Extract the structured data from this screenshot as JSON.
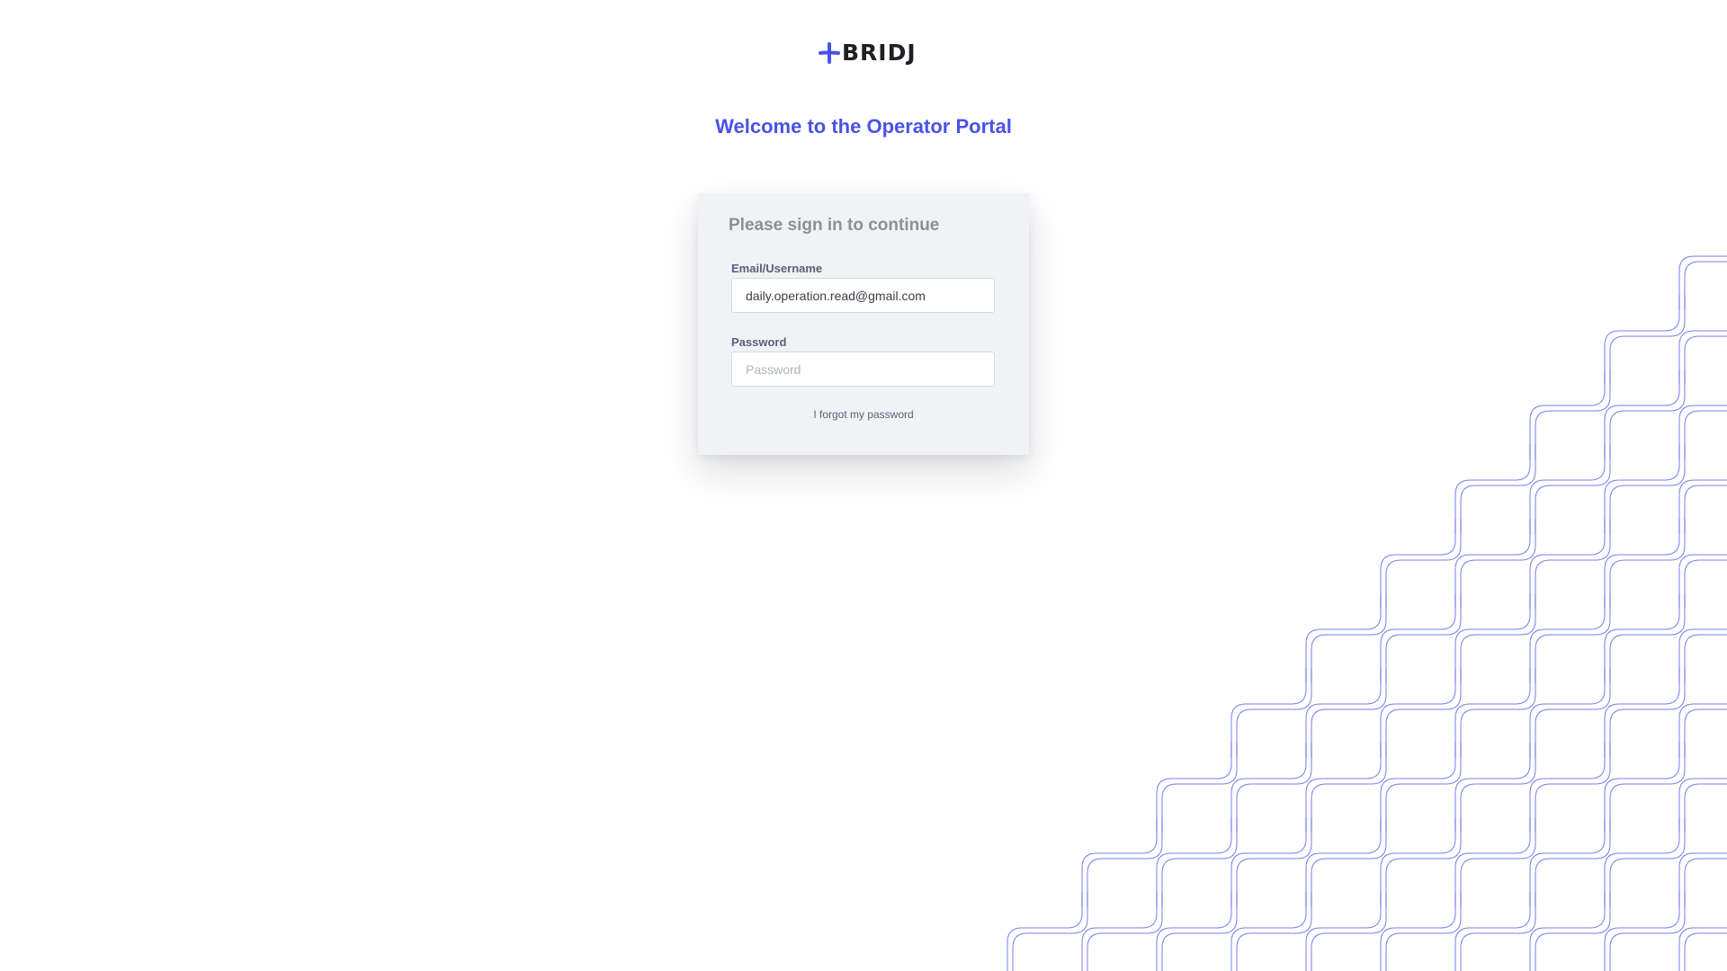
{
  "brand": {
    "name": "BRIDJ",
    "accent_color": "#4a52e6",
    "icon": "plus-icon"
  },
  "welcome_heading": "Welcome to the Operator Portal",
  "login": {
    "title": "Please sign in to continue",
    "email_label": "Email/Username",
    "email_value": "daily.operation.read@gmail.com",
    "password_label": "Password",
    "password_placeholder": "Password",
    "forgot_link": "I forgot my password"
  }
}
